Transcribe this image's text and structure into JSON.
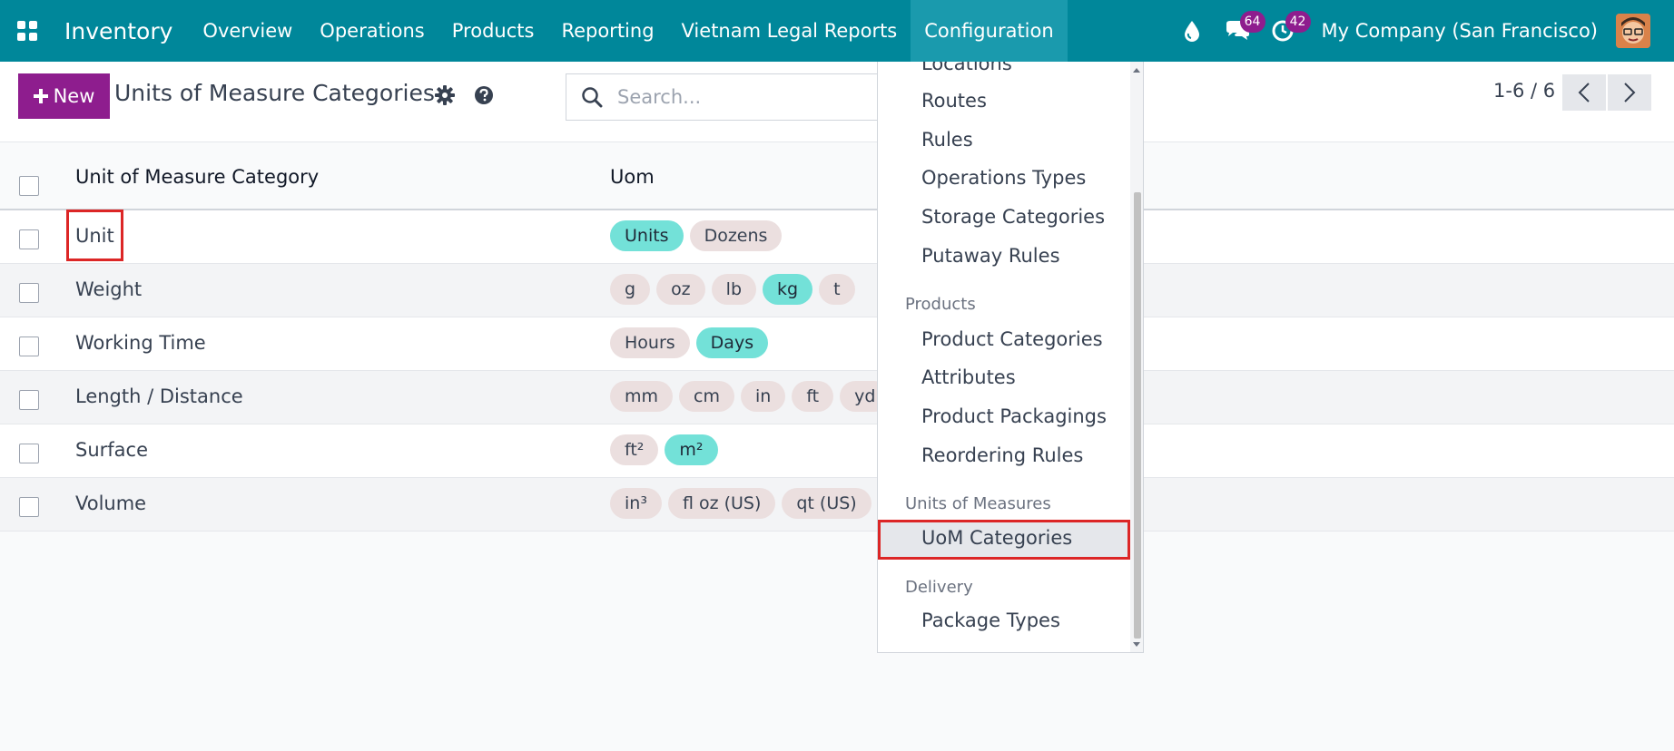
{
  "navbar": {
    "app_name": "Inventory",
    "menu": [
      "Overview",
      "Operations",
      "Products",
      "Reporting",
      "Vietnam Legal Reports",
      "Configuration"
    ],
    "active_menu": "Configuration",
    "messages_count": "64",
    "activities_count": "42",
    "company": "My Company (San Francisco)"
  },
  "control": {
    "new_label": "New",
    "title": "Units of Measure Categories",
    "search_placeholder": "Search...",
    "pager": "1-6 / 6"
  },
  "table": {
    "headers": [
      "Unit of Measure Category",
      "Uom"
    ],
    "rows": [
      {
        "category": "Unit",
        "uoms": [
          {
            "label": "Units",
            "ref": true
          },
          {
            "label": "Dozens",
            "ref": false
          }
        ]
      },
      {
        "category": "Weight",
        "uoms": [
          {
            "label": "g",
            "ref": false
          },
          {
            "label": "oz",
            "ref": false
          },
          {
            "label": "lb",
            "ref": false
          },
          {
            "label": "kg",
            "ref": true
          },
          {
            "label": "t",
            "ref": false
          }
        ]
      },
      {
        "category": "Working Time",
        "uoms": [
          {
            "label": "Hours",
            "ref": false
          },
          {
            "label": "Days",
            "ref": true
          }
        ]
      },
      {
        "category": "Length / Distance",
        "uoms": [
          {
            "label": "mm",
            "ref": false
          },
          {
            "label": "cm",
            "ref": false
          },
          {
            "label": "in",
            "ref": false
          },
          {
            "label": "ft",
            "ref": false
          },
          {
            "label": "yd",
            "ref": false
          }
        ]
      },
      {
        "category": "Surface",
        "uoms": [
          {
            "label": "ft²",
            "ref": false
          },
          {
            "label": "m²",
            "ref": true
          }
        ]
      },
      {
        "category": "Volume",
        "uoms": [
          {
            "label": "in³",
            "ref": false
          },
          {
            "label": "fl oz (US)",
            "ref": false
          },
          {
            "label": "qt (US)",
            "ref": false
          }
        ]
      }
    ]
  },
  "dropdown": {
    "items_top": [
      "Locations",
      "Routes",
      "Rules",
      "Operations Types",
      "Storage Categories",
      "Putaway Rules"
    ],
    "section_products": "Products",
    "items_products": [
      "Product Categories",
      "Attributes",
      "Product Packagings",
      "Reordering Rules"
    ],
    "section_uom": "Units of Measures",
    "item_uom": "UoM Categories",
    "section_delivery": "Delivery",
    "item_delivery": "Package Types"
  },
  "colors": {
    "navbar": "#00879a",
    "primary_button": "#8e1d8e",
    "reference_tag": "#73e1d8",
    "tag": "#ebdfdf",
    "highlight": "#dc2626"
  },
  "icons": [
    "apps-grid-icon",
    "drop-icon",
    "chat-icon",
    "clock-icon",
    "gear-icon",
    "help-icon",
    "search-icon",
    "chevron-left-icon",
    "chevron-right-icon",
    "plus-icon"
  ]
}
